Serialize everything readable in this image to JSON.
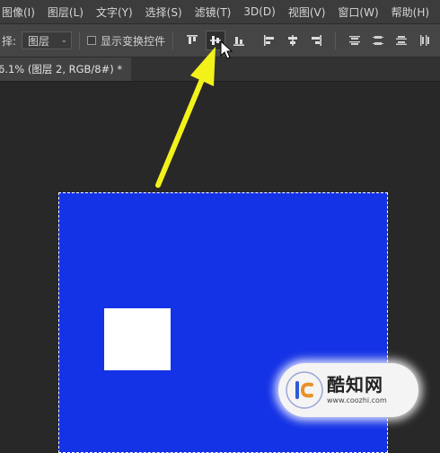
{
  "menubar": {
    "items": [
      "图像(I)",
      "图层(L)",
      "文字(Y)",
      "选择(S)",
      "滤镜(T)",
      "3D(D)",
      "视图(V)",
      "窗口(W)",
      "帮助(H)"
    ]
  },
  "options": {
    "select_label": "择:",
    "select_value": "图层",
    "show_transform_label": "显示变换控件"
  },
  "tab": {
    "title": "6.1% (图层 2, RGB/8#) *",
    "close": "×"
  },
  "colors": {
    "canvas_fill": "#1432e6",
    "arrow": "#f2f21a"
  },
  "watermark": {
    "name": "酷知网",
    "url": "www.coozhi.com"
  }
}
